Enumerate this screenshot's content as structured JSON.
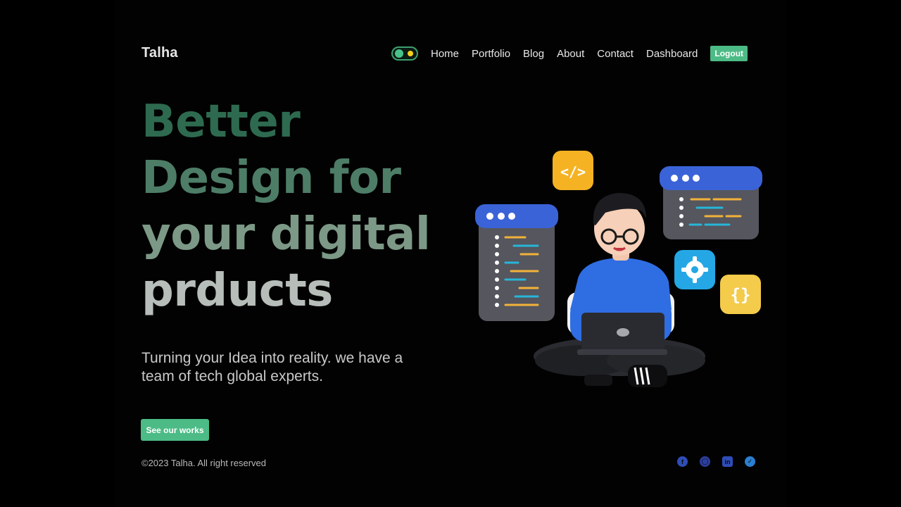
{
  "header": {
    "brand": "Talha",
    "nav": [
      "Home",
      "Portfolio",
      "Blog",
      "About",
      "Contact",
      "Dashboard"
    ],
    "logout_label": "Logout",
    "theme_toggle": "dark"
  },
  "hero": {
    "title_lines": [
      "Better",
      "Design for",
      "your digital",
      "prducts"
    ],
    "tagline": "Turning your Idea into reality. we have a team of tech global experts.",
    "cta_label": "See our works"
  },
  "footer": {
    "copyright": "©2023 Talha. All right reserved",
    "socials": [
      "facebook-icon",
      "github-icon",
      "linkedin-icon",
      "twitter-icon"
    ]
  },
  "colors": {
    "accent": "#4cbb85",
    "background": "#000000"
  }
}
